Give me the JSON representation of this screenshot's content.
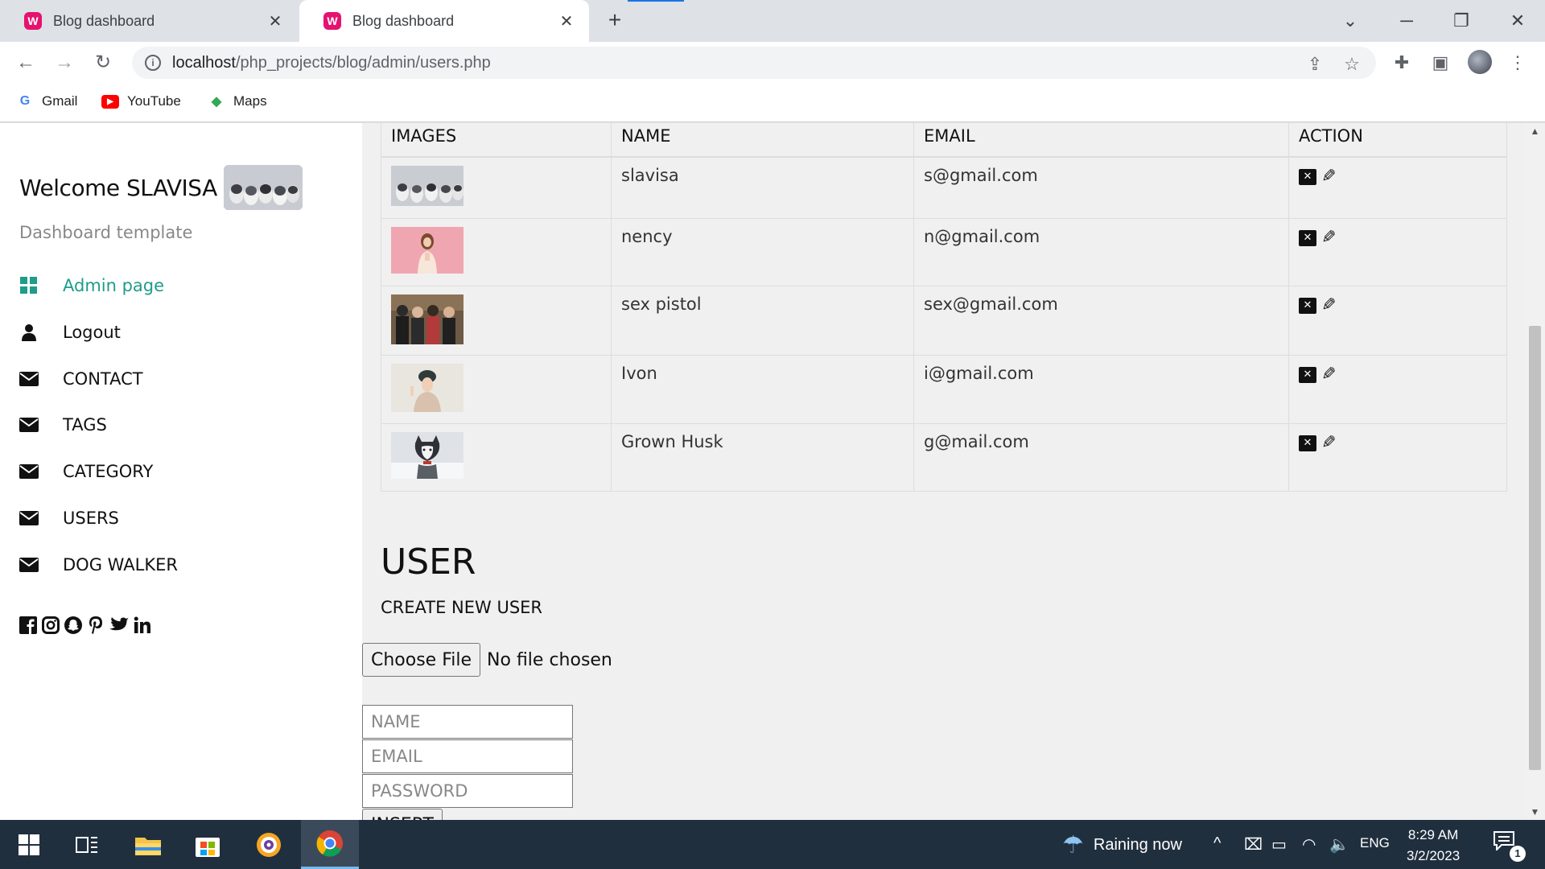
{
  "browser": {
    "tabs": [
      {
        "title": "Blog dashboard",
        "active": false
      },
      {
        "title": "Blog dashboard",
        "active": true
      }
    ],
    "url_host": "localhost",
    "url_path": "/php_projects/blog/admin/users.php",
    "bookmarks": [
      {
        "label": "Gmail",
        "icon": "google-icon"
      },
      {
        "label": "YouTube",
        "icon": "youtube-icon"
      },
      {
        "label": "Maps",
        "icon": "maps-icon"
      }
    ],
    "accent": "#1a73e8"
  },
  "sidebar": {
    "welcome": "Welcome SLAVISA",
    "subtitle": "Dashboard template",
    "items": [
      {
        "label": "Admin page",
        "icon": "grid-icon"
      },
      {
        "label": "Logout",
        "icon": "user-icon"
      },
      {
        "label": "CONTACT",
        "icon": "envelope-icon"
      },
      {
        "label": "TAGS",
        "icon": "envelope-icon"
      },
      {
        "label": "CATEGORY",
        "icon": "envelope-icon"
      },
      {
        "label": "USERS",
        "icon": "envelope-icon"
      },
      {
        "label": "DOG WALKER",
        "icon": "envelope-icon"
      }
    ],
    "social": [
      "facebook-icon",
      "instagram-icon",
      "snapchat-icon",
      "pinterest-icon",
      "twitter-icon",
      "linkedin-icon"
    ],
    "active_color": "#1f9c8a"
  },
  "table": {
    "headers": {
      "images": "IMAGES",
      "name": "NAME",
      "email": "EMAIL",
      "action": "ACTION"
    },
    "rows": [
      {
        "name": "slavisa",
        "email": "s@gmail.com",
        "image": "husky-puppies"
      },
      {
        "name": "nency",
        "email": "n@gmail.com",
        "image": "woman-pink-background"
      },
      {
        "name": "sex pistol",
        "email": "sex@gmail.com",
        "image": "band-photo"
      },
      {
        "name": "Ivon",
        "email": "i@gmail.com",
        "image": "woman-beanie"
      },
      {
        "name": "Grown Husk",
        "email": "g@mail.com",
        "image": "husky-snow"
      }
    ]
  },
  "form": {
    "title": "USER",
    "subtitle": "CREATE NEW USER",
    "file_button": "Choose File",
    "file_status": "No file chosen",
    "name_placeholder": "NAME",
    "email_placeholder": "EMAIL",
    "password_placeholder": "PASSWORD",
    "submit": "INSERT"
  },
  "taskbar": {
    "weather": "Raining now",
    "lang": "ENG",
    "time": "8:29 AM",
    "date": "3/2/2023",
    "notifications": "1"
  }
}
